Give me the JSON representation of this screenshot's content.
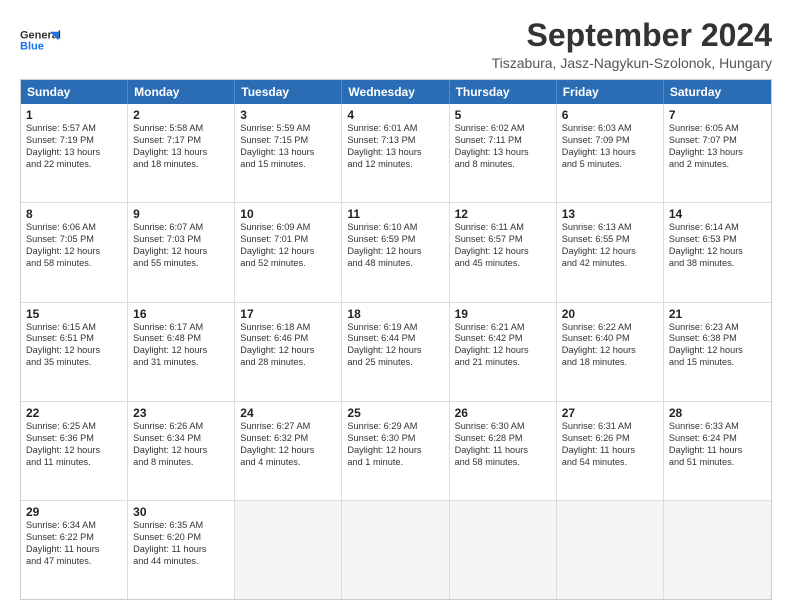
{
  "logo": {
    "line1": "General",
    "line2": "Blue"
  },
  "title": "September 2024",
  "subtitle": "Tiszabura, Jasz-Nagykun-Szolonok, Hungary",
  "headers": [
    "Sunday",
    "Monday",
    "Tuesday",
    "Wednesday",
    "Thursday",
    "Friday",
    "Saturday"
  ],
  "weeks": [
    [
      {
        "day": "1",
        "lines": [
          "Sunrise: 5:57 AM",
          "Sunset: 7:19 PM",
          "Daylight: 13 hours",
          "and 22 minutes."
        ]
      },
      {
        "day": "2",
        "lines": [
          "Sunrise: 5:58 AM",
          "Sunset: 7:17 PM",
          "Daylight: 13 hours",
          "and 18 minutes."
        ]
      },
      {
        "day": "3",
        "lines": [
          "Sunrise: 5:59 AM",
          "Sunset: 7:15 PM",
          "Daylight: 13 hours",
          "and 15 minutes."
        ]
      },
      {
        "day": "4",
        "lines": [
          "Sunrise: 6:01 AM",
          "Sunset: 7:13 PM",
          "Daylight: 13 hours",
          "and 12 minutes."
        ]
      },
      {
        "day": "5",
        "lines": [
          "Sunrise: 6:02 AM",
          "Sunset: 7:11 PM",
          "Daylight: 13 hours",
          "and 8 minutes."
        ]
      },
      {
        "day": "6",
        "lines": [
          "Sunrise: 6:03 AM",
          "Sunset: 7:09 PM",
          "Daylight: 13 hours",
          "and 5 minutes."
        ]
      },
      {
        "day": "7",
        "lines": [
          "Sunrise: 6:05 AM",
          "Sunset: 7:07 PM",
          "Daylight: 13 hours",
          "and 2 minutes."
        ]
      }
    ],
    [
      {
        "day": "8",
        "lines": [
          "Sunrise: 6:06 AM",
          "Sunset: 7:05 PM",
          "Daylight: 12 hours",
          "and 58 minutes."
        ]
      },
      {
        "day": "9",
        "lines": [
          "Sunrise: 6:07 AM",
          "Sunset: 7:03 PM",
          "Daylight: 12 hours",
          "and 55 minutes."
        ]
      },
      {
        "day": "10",
        "lines": [
          "Sunrise: 6:09 AM",
          "Sunset: 7:01 PM",
          "Daylight: 12 hours",
          "and 52 minutes."
        ]
      },
      {
        "day": "11",
        "lines": [
          "Sunrise: 6:10 AM",
          "Sunset: 6:59 PM",
          "Daylight: 12 hours",
          "and 48 minutes."
        ]
      },
      {
        "day": "12",
        "lines": [
          "Sunrise: 6:11 AM",
          "Sunset: 6:57 PM",
          "Daylight: 12 hours",
          "and 45 minutes."
        ]
      },
      {
        "day": "13",
        "lines": [
          "Sunrise: 6:13 AM",
          "Sunset: 6:55 PM",
          "Daylight: 12 hours",
          "and 42 minutes."
        ]
      },
      {
        "day": "14",
        "lines": [
          "Sunrise: 6:14 AM",
          "Sunset: 6:53 PM",
          "Daylight: 12 hours",
          "and 38 minutes."
        ]
      }
    ],
    [
      {
        "day": "15",
        "lines": [
          "Sunrise: 6:15 AM",
          "Sunset: 6:51 PM",
          "Daylight: 12 hours",
          "and 35 minutes."
        ]
      },
      {
        "day": "16",
        "lines": [
          "Sunrise: 6:17 AM",
          "Sunset: 6:48 PM",
          "Daylight: 12 hours",
          "and 31 minutes."
        ]
      },
      {
        "day": "17",
        "lines": [
          "Sunrise: 6:18 AM",
          "Sunset: 6:46 PM",
          "Daylight: 12 hours",
          "and 28 minutes."
        ]
      },
      {
        "day": "18",
        "lines": [
          "Sunrise: 6:19 AM",
          "Sunset: 6:44 PM",
          "Daylight: 12 hours",
          "and 25 minutes."
        ]
      },
      {
        "day": "19",
        "lines": [
          "Sunrise: 6:21 AM",
          "Sunset: 6:42 PM",
          "Daylight: 12 hours",
          "and 21 minutes."
        ]
      },
      {
        "day": "20",
        "lines": [
          "Sunrise: 6:22 AM",
          "Sunset: 6:40 PM",
          "Daylight: 12 hours",
          "and 18 minutes."
        ]
      },
      {
        "day": "21",
        "lines": [
          "Sunrise: 6:23 AM",
          "Sunset: 6:38 PM",
          "Daylight: 12 hours",
          "and 15 minutes."
        ]
      }
    ],
    [
      {
        "day": "22",
        "lines": [
          "Sunrise: 6:25 AM",
          "Sunset: 6:36 PM",
          "Daylight: 12 hours",
          "and 11 minutes."
        ]
      },
      {
        "day": "23",
        "lines": [
          "Sunrise: 6:26 AM",
          "Sunset: 6:34 PM",
          "Daylight: 12 hours",
          "and 8 minutes."
        ]
      },
      {
        "day": "24",
        "lines": [
          "Sunrise: 6:27 AM",
          "Sunset: 6:32 PM",
          "Daylight: 12 hours",
          "and 4 minutes."
        ]
      },
      {
        "day": "25",
        "lines": [
          "Sunrise: 6:29 AM",
          "Sunset: 6:30 PM",
          "Daylight: 12 hours",
          "and 1 minute."
        ]
      },
      {
        "day": "26",
        "lines": [
          "Sunrise: 6:30 AM",
          "Sunset: 6:28 PM",
          "Daylight: 11 hours",
          "and 58 minutes."
        ]
      },
      {
        "day": "27",
        "lines": [
          "Sunrise: 6:31 AM",
          "Sunset: 6:26 PM",
          "Daylight: 11 hours",
          "and 54 minutes."
        ]
      },
      {
        "day": "28",
        "lines": [
          "Sunrise: 6:33 AM",
          "Sunset: 6:24 PM",
          "Daylight: 11 hours",
          "and 51 minutes."
        ]
      }
    ],
    [
      {
        "day": "29",
        "lines": [
          "Sunrise: 6:34 AM",
          "Sunset: 6:22 PM",
          "Daylight: 11 hours",
          "and 47 minutes."
        ]
      },
      {
        "day": "30",
        "lines": [
          "Sunrise: 6:35 AM",
          "Sunset: 6:20 PM",
          "Daylight: 11 hours",
          "and 44 minutes."
        ]
      },
      {
        "day": "",
        "lines": []
      },
      {
        "day": "",
        "lines": []
      },
      {
        "day": "",
        "lines": []
      },
      {
        "day": "",
        "lines": []
      },
      {
        "day": "",
        "lines": []
      }
    ]
  ]
}
